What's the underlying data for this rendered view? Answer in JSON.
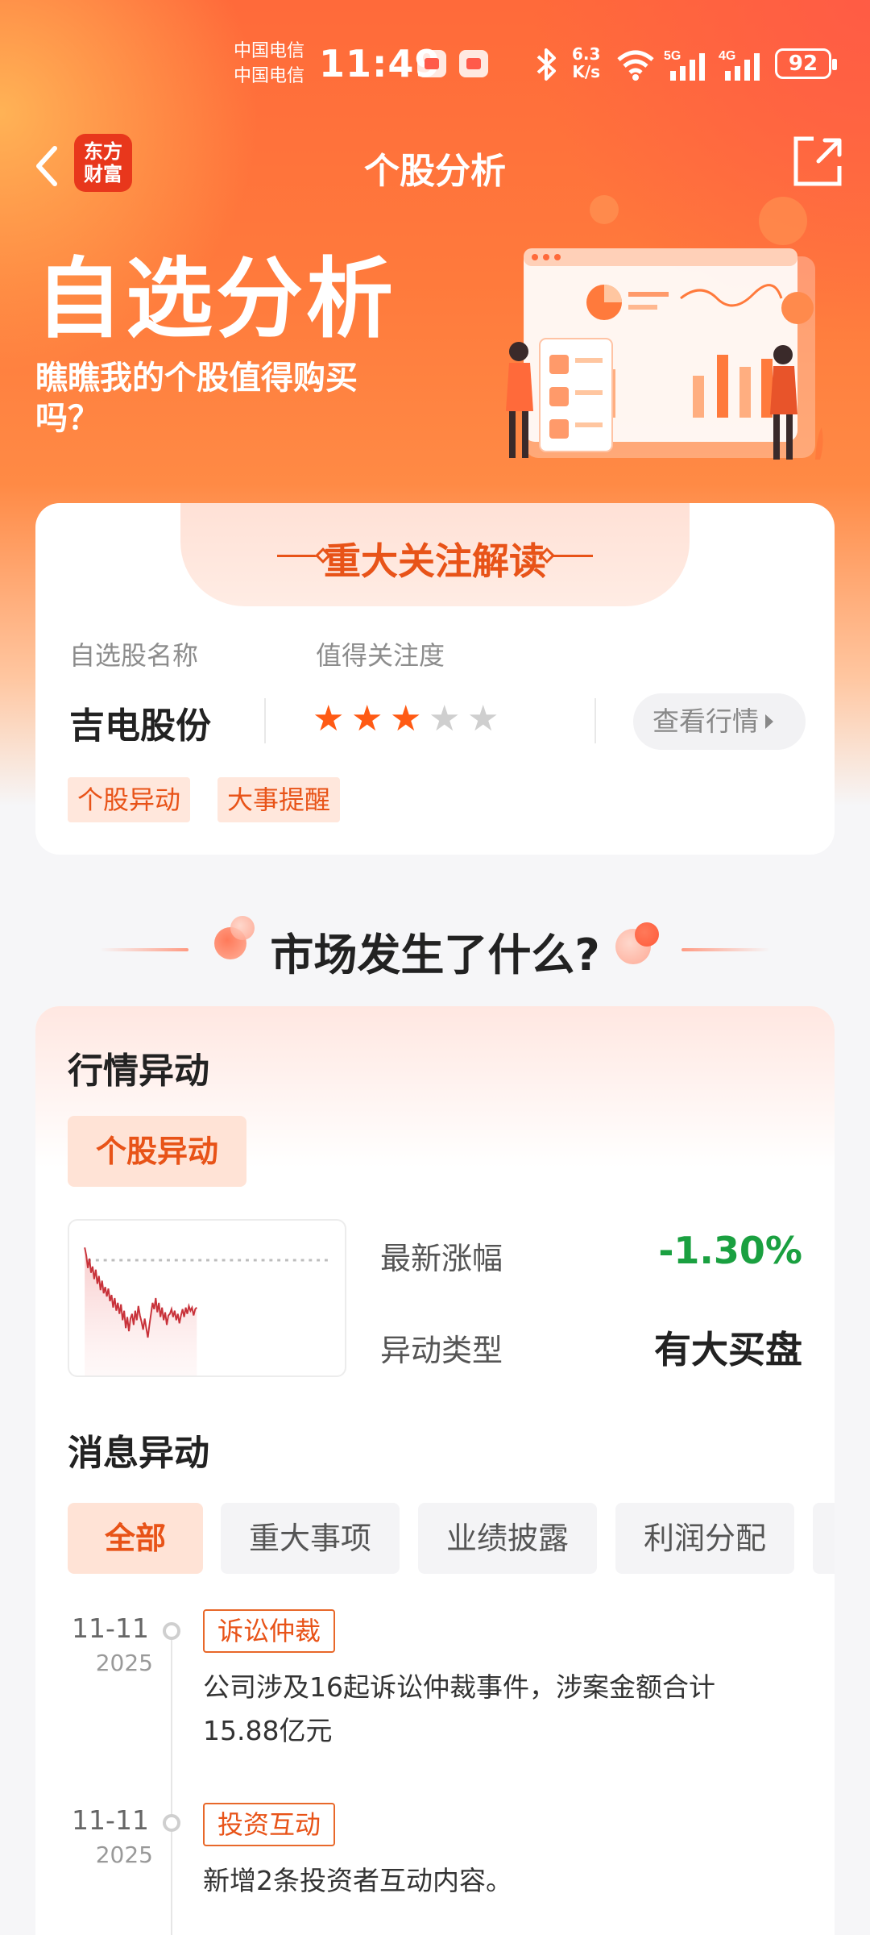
{
  "status_bar": {
    "carrier_1": "中国电信",
    "carrier_2": "中国电信",
    "time": "11:49",
    "net_speed_value": "6.3",
    "net_speed_unit": "K/s",
    "signal_1": "5G",
    "signal_2": "4G",
    "battery": "92",
    "icons": [
      "app-badge-icon",
      "book-icon",
      "bluetooth-icon",
      "wifi-icon",
      "signal-5g-icon",
      "signal-4g-icon",
      "battery-icon"
    ]
  },
  "nav": {
    "title": "个股分析",
    "logo_line1": "东方",
    "logo_line2": "财富",
    "back_icon": "chevron-left-icon",
    "share_icon": "share-icon"
  },
  "hero": {
    "title": "自选分析",
    "subtitle": "瞧瞧我的个股值得购买吗？"
  },
  "focus_card": {
    "header": "重大关注解读",
    "label_name": "自选股名称",
    "label_attention": "值得关注度",
    "stock_name": "吉电股份",
    "rating": 3,
    "rating_max": 5,
    "view_quote_label": "查看行情",
    "tags": [
      "个股异动",
      "大事提醒"
    ]
  },
  "market_section": {
    "title": "市场发生了什么?"
  },
  "quote_card": {
    "heading": "行情异动",
    "tag": "个股异动",
    "latest_change_label": "最新涨幅",
    "latest_change_value": "-1.30%",
    "anomaly_type_label": "异动类型",
    "anomaly_type_value": "有大买盘",
    "colors": {
      "down": "#1aa040",
      "accent": "#e85318"
    }
  },
  "news": {
    "heading": "消息异动",
    "filters": [
      "全部",
      "重大事项",
      "业绩披露",
      "利润分配"
    ],
    "active_filter": "全部",
    "items": [
      {
        "date": "11-11",
        "year": "2025",
        "tag": "诉讼仲裁",
        "text": "公司涉及16起诉讼仲裁事件，涉案金额合计15.88亿元"
      },
      {
        "date": "11-11",
        "year": "2025",
        "tag": "投资互动",
        "text": "新增2条投资者互动内容。"
      }
    ]
  }
}
